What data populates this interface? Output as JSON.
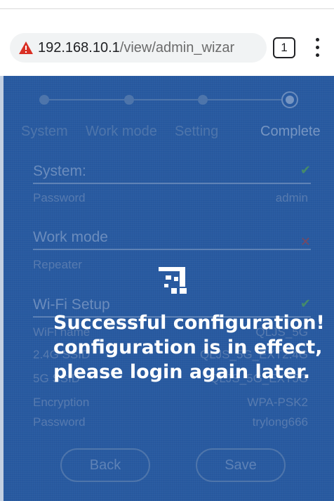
{
  "browser": {
    "url_host": "192.168.10.1",
    "url_path": "/view/admin_wizar",
    "tab_count": "1",
    "warning_icon": "warning-triangle-icon",
    "menu_icon": "kebab-menu-icon",
    "warning_color": "#d93025"
  },
  "wizard": {
    "steps": [
      {
        "label": "System"
      },
      {
        "label": "Work mode"
      },
      {
        "label": "Setting"
      },
      {
        "label": "Complete"
      }
    ],
    "active_step": "Complete",
    "system": {
      "title": "System:",
      "status": "ok",
      "rows": [
        {
          "label": "Password",
          "value": "admin"
        }
      ]
    },
    "work_mode": {
      "title": "Work mode",
      "status": "error",
      "rows": [
        {
          "label": "Repeater",
          "value": ""
        }
      ]
    },
    "wifi": {
      "title": "Wi-Fi Setup",
      "status": "ok",
      "rows": [
        {
          "label": "WiFi name",
          "value": "QLJS_5G"
        },
        {
          "label": "2.4G SSID",
          "value": "QLJS_5G_EXT2.4G"
        },
        {
          "label": "5G SSID",
          "value": "QLJS_5G_EXT5G"
        },
        {
          "label": "Encryption",
          "value": "WPA-PSK2"
        },
        {
          "label": "Password",
          "value": "trylong666"
        }
      ]
    },
    "buttons": {
      "back": "Back",
      "save": "Save"
    }
  },
  "overlay": {
    "line1": "Successful configuration!",
    "line2": "configuration is in effect,",
    "line3": "please login again later.",
    "loader_icon": "loading-spinner-icon"
  },
  "colors": {
    "page_background": "#2b5fa6",
    "ok": "#4f9a63",
    "error": "#8a4a5a"
  }
}
